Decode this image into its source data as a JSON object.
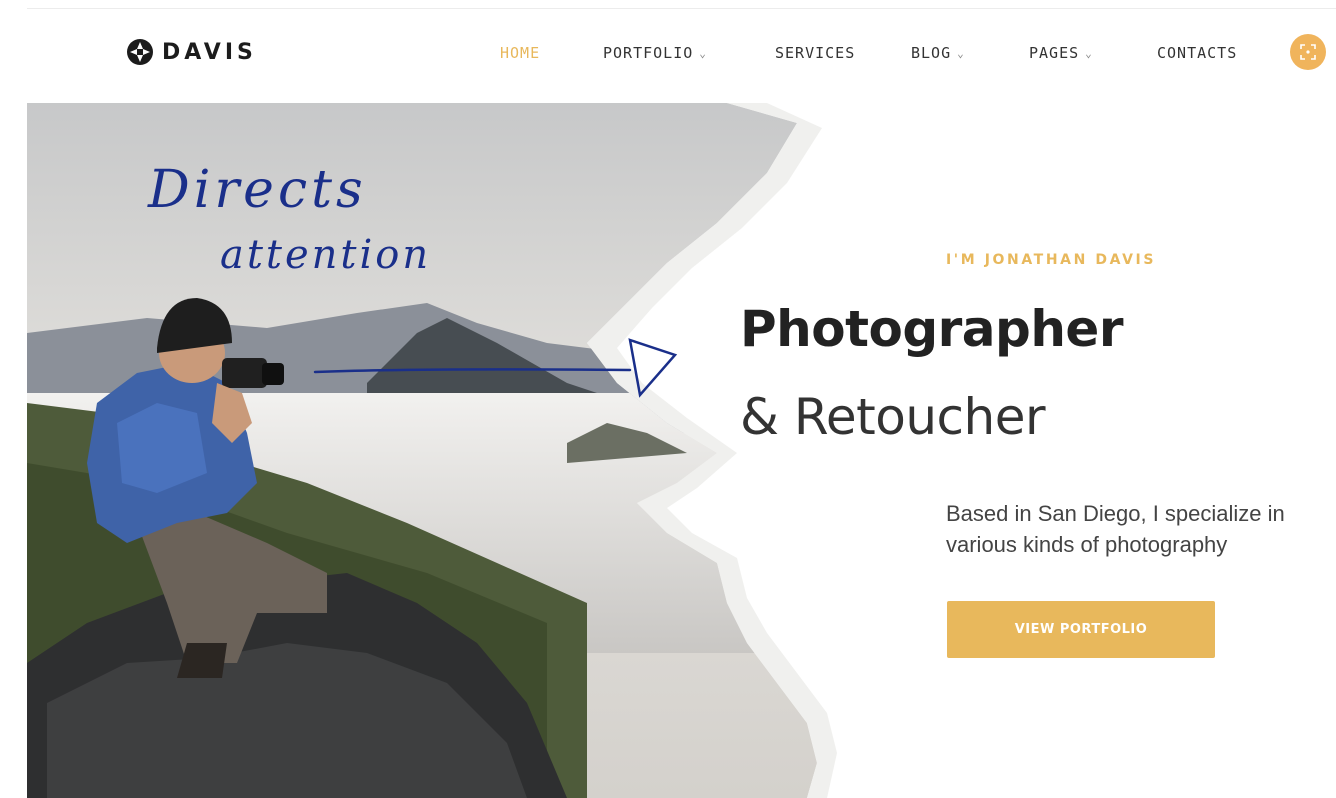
{
  "header": {
    "logo_text": "DAVIS",
    "nav": [
      {
        "label": "HOME",
        "active": true,
        "dropdown": false
      },
      {
        "label": "PORTFOLIO",
        "active": false,
        "dropdown": true
      },
      {
        "label": "SERVICES",
        "active": false,
        "dropdown": false
      },
      {
        "label": "BLOG",
        "active": false,
        "dropdown": true
      },
      {
        "label": "PAGES",
        "active": false,
        "dropdown": true
      },
      {
        "label": "CONTACTS",
        "active": false,
        "dropdown": false
      }
    ],
    "chevron_icon": "chevron-down-icon",
    "round_button_icon": "focus-icon"
  },
  "hero": {
    "eyebrow": "I'M JONATHAN DAVIS",
    "title": "Photographer",
    "subtitle": "& Retoucher",
    "description": "Based in San Diego, I specialize in various kinds of photography",
    "cta_label": "VIEW PORTFOLIO"
  },
  "annotation": {
    "line1": "Directs",
    "line2": "attention"
  },
  "colors": {
    "accent": "#e8b85c",
    "ink": "#1a2f8a"
  }
}
